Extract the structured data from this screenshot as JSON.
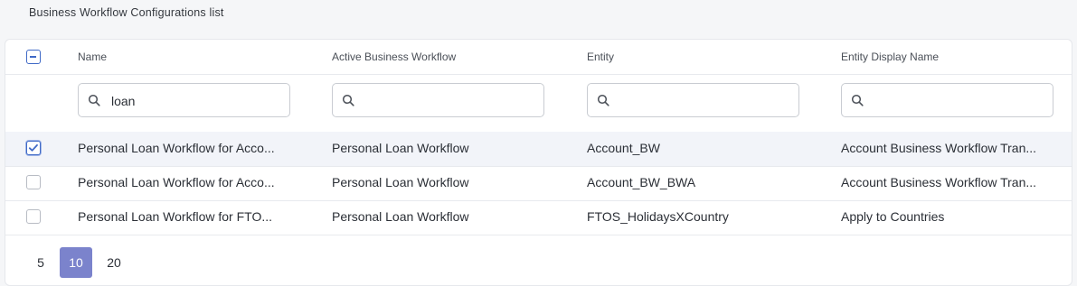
{
  "page": {
    "title": "Business Workflow Configurations list"
  },
  "table": {
    "columns": [
      "Name",
      "Active Business Workflow",
      "Entity",
      "Entity Display Name"
    ],
    "filters": [
      {
        "value": "loan",
        "placeholder": ""
      },
      {
        "value": "",
        "placeholder": ""
      },
      {
        "value": "",
        "placeholder": ""
      },
      {
        "value": "",
        "placeholder": ""
      }
    ],
    "select_all_state": "indeterminate",
    "rows": [
      {
        "checked": true,
        "cells": [
          "Personal Loan Workflow for Acco...",
          "Personal Loan Workflow",
          "Account_BW",
          "Account Business Workflow Tran..."
        ]
      },
      {
        "checked": false,
        "cells": [
          "Personal Loan Workflow for Acco...",
          "Personal Loan Workflow",
          "Account_BW_BWA",
          "Account Business Workflow Tran..."
        ]
      },
      {
        "checked": false,
        "cells": [
          "Personal Loan Workflow for FTO...",
          "Personal Loan Workflow",
          "FTOS_HolidaysXCountry",
          "Apply to Countries"
        ]
      }
    ]
  },
  "pagination": {
    "page_sizes": [
      "5",
      "10",
      "20"
    ],
    "selected": "10",
    "accent_color": "#7b83cc"
  },
  "icons": {
    "search": "search-icon",
    "checkbox": "checkbox-icon"
  }
}
